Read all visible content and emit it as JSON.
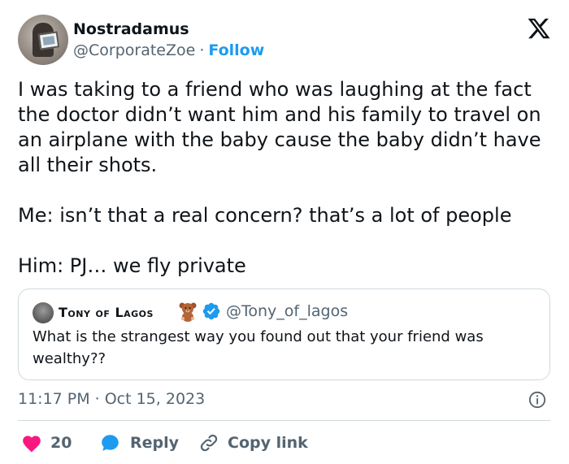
{
  "author": {
    "name": "Nostradamus",
    "handle": "@CorporateZoe",
    "separator": "·",
    "follow_label": "Follow"
  },
  "tweet": {
    "paragraphs": [
      "I was taking to a friend who was laughing at the fact the doctor didn’t want him and his family to travel on an airplane with the baby cause the baby didn’t have all their shots.",
      "Me: isn’t that a real concern? that’s a lot of people",
      "Him: PJ… we fly private"
    ]
  },
  "quote": {
    "name": "Tony of Lagos",
    "handle": "@Tony_of_lagos",
    "text": "What is the strangest way you found out that your friend was wealthy??"
  },
  "meta": {
    "time": "11:17 PM",
    "separator": "·",
    "date": "Oct 15, 2023"
  },
  "actions": {
    "like_count": "20",
    "reply_label": "Reply",
    "copy_label": "Copy link"
  },
  "colors": {
    "accent": "#1d9bf0",
    "like": "#f91880",
    "muted": "#536471",
    "text": "#0f1419",
    "border": "#cfd9de"
  },
  "icons": [
    "x-logo-icon",
    "verified-badge-icon",
    "teddy-bear-emoji-icon",
    "info-icon",
    "heart-icon",
    "reply-bubble-icon",
    "link-icon"
  ]
}
